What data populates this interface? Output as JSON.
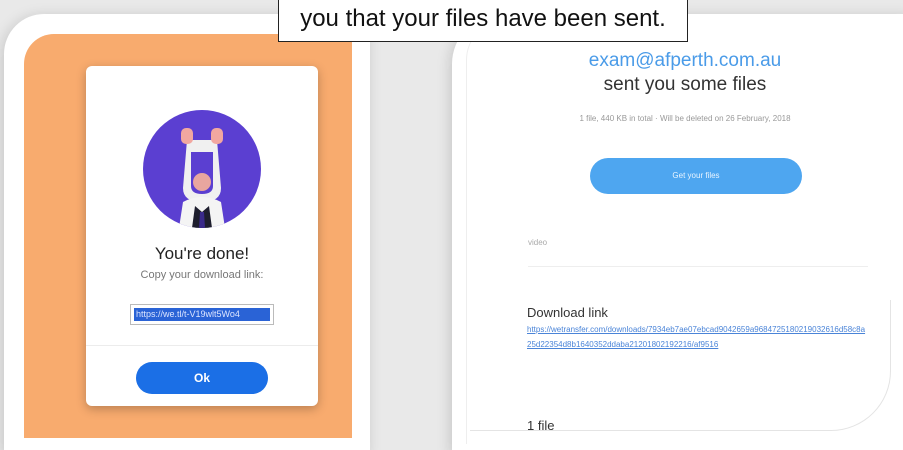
{
  "caption": {
    "text": "you that your files have been sent."
  },
  "done_dialog": {
    "title": "You're done!",
    "subtitle": "Copy your download link:",
    "link_value": "https://we.tl/t-V19wlt5Wo4",
    "ok_label": "Ok"
  },
  "email": {
    "sender": "exam@afperth.com.au",
    "message": "sent you some files",
    "meta": "1 file, 440 KB in total  ·  Will be deleted on 26 February, 2018",
    "get_files_label": "Get your files",
    "file_name": "video",
    "download_link_title": "Download link",
    "download_url": "https://wetransfer.com/downloads/7934eb7ae07ebcad9042659a9684725180219032616d58c8a25d22354d8b1640352ddaba21201802192216/af9516",
    "file_count": "1 file"
  },
  "colors": {
    "orange_bg": "#f8ab6e",
    "avatar_purple": "#5b3fd1",
    "ok_blue": "#1b6fe6",
    "get_files_blue": "#4ea6f0",
    "sender_blue": "#4a9be8",
    "link_blue": "#4a84d8"
  },
  "icons": {
    "avatar": "hands-raised-illustration"
  }
}
